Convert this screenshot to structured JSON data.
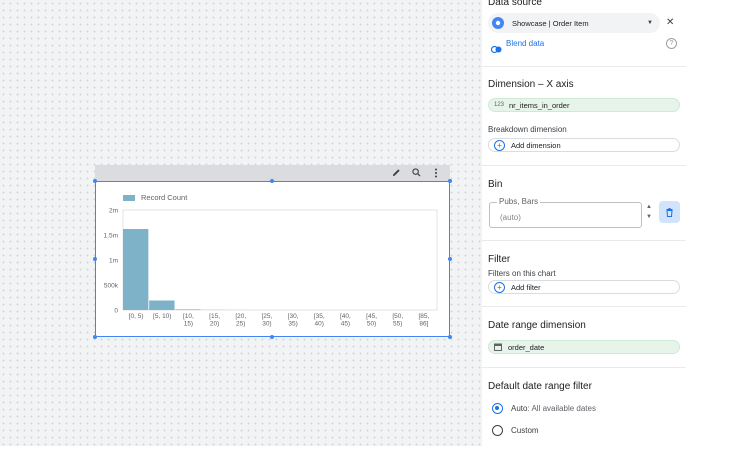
{
  "colors": {
    "accent": "#1a73e8",
    "bar": "#7eb2c9",
    "selection": "#4285f4",
    "field_green": "#e6f4ea",
    "canvas": "#f1f3f4"
  },
  "chart_toolbar": {
    "icons": [
      "pencil-icon",
      "zoom-icon",
      "more-vert-icon"
    ]
  },
  "chart_data": {
    "type": "bar",
    "categories": [
      "[0, 5)",
      "[5, 10)",
      "[10, 15)",
      "[15, 20)",
      "[20, 25)",
      "[25, 30)",
      "[30, 35)",
      "[35, 40)",
      "[40, 45)",
      "[45, 50)",
      "[50, 55)",
      "[85, 86]"
    ],
    "category_lines": [
      [
        "[0, 5)"
      ],
      [
        "[5, 10)"
      ],
      [
        "[10,",
        "15)"
      ],
      [
        "[15,",
        "20)"
      ],
      [
        "[20,",
        "25)"
      ],
      [
        "[25,",
        "30)"
      ],
      [
        "[30,",
        "35)"
      ],
      [
        "[35,",
        "40)"
      ],
      [
        "[40,",
        "45)"
      ],
      [
        "[45,",
        "50)"
      ],
      [
        "[50,",
        "55)"
      ],
      [
        "[85,",
        "86]"
      ]
    ],
    "series": [
      {
        "name": "Record Count",
        "values": [
          1620000,
          190000,
          12000,
          2500,
          800,
          300,
          150,
          80,
          40,
          20,
          10,
          5
        ]
      }
    ],
    "y_ticks": [
      0,
      500000,
      1000000,
      1500000,
      2000000
    ],
    "y_tick_labels": [
      "0",
      "500k",
      "1m",
      "1.5m",
      "2m"
    ],
    "ylim": [
      0,
      2000000
    ],
    "legend": "top-left",
    "grid": false,
    "title": "",
    "xlabel": "",
    "ylabel": ""
  },
  "panel": {
    "data_source": {
      "title": "Data source",
      "source_name": "Showcase | Order Item",
      "blend_label": "Blend data"
    },
    "dimension": {
      "title": "Dimension – X axis",
      "type_badge": "123",
      "field": "nr_items_in_order",
      "breakdown_label": "Breakdown dimension",
      "add_label": "Add dimension"
    },
    "bin": {
      "title": "Bin",
      "legend": "Pubs, Bars",
      "value": "(auto)"
    },
    "filter": {
      "title": "Filter",
      "sub_label": "Filters on this chart",
      "add_label": "Add filter"
    },
    "date_range_dimension": {
      "title": "Date range dimension",
      "field": "order_date"
    },
    "default_date_range": {
      "title": "Default date range filter",
      "auto_label": "Auto",
      "auto_desc": ": All available dates",
      "custom_label": "Custom"
    }
  }
}
